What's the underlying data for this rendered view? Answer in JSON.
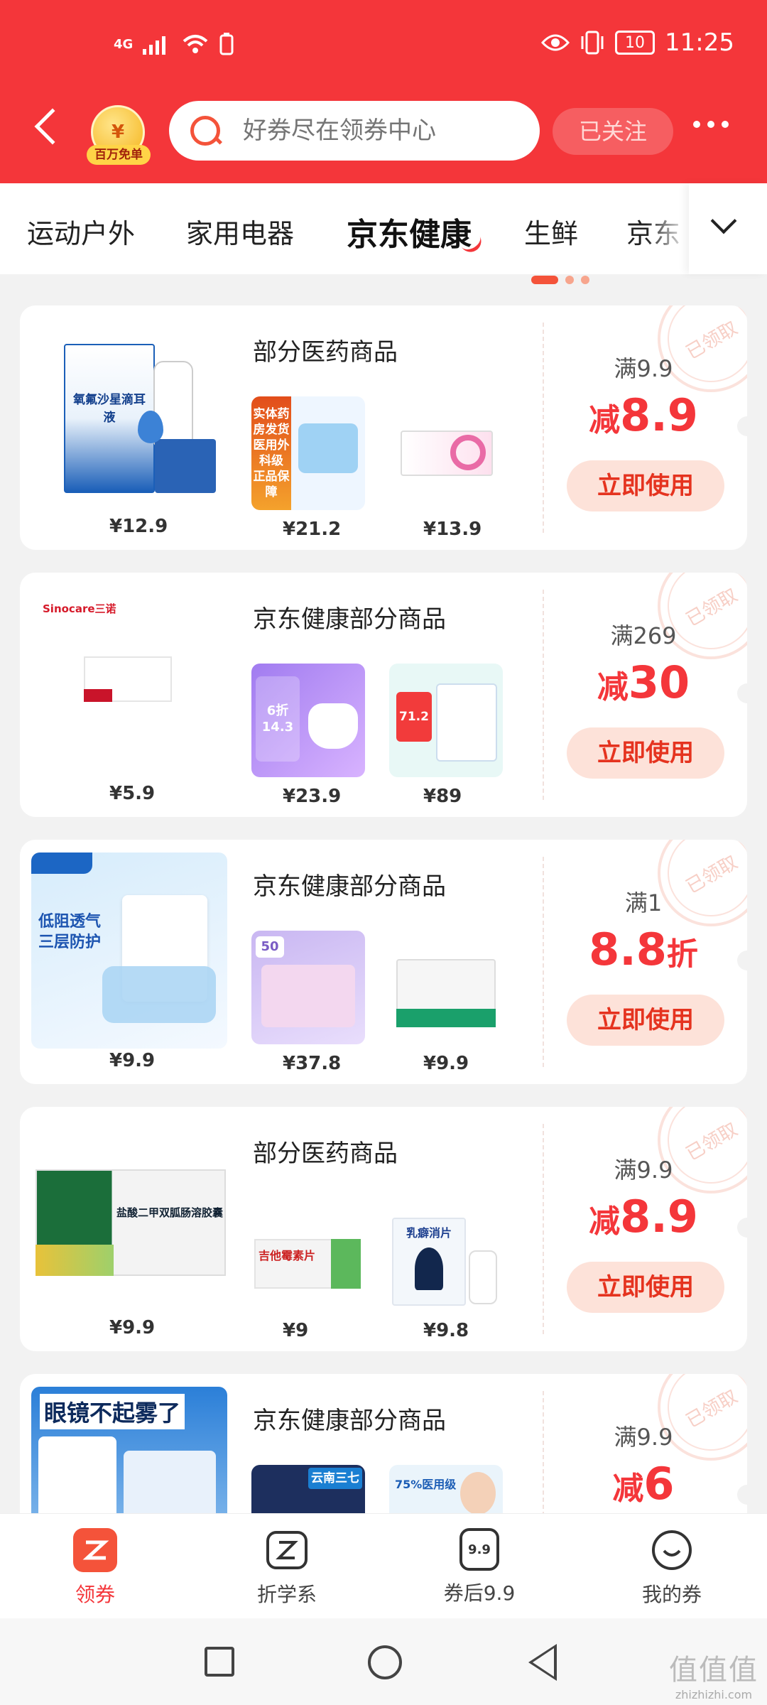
{
  "status_bar": {
    "network": "4G",
    "battery": "10",
    "time": "11:25"
  },
  "header": {
    "badge_label": "百万免单",
    "coin_symbol": "¥",
    "search_placeholder": "好券尽在领券中心",
    "follow_label": "已关注"
  },
  "tabs": [
    "运动户外",
    "家用电器",
    "京东健康",
    "生鲜",
    "京东"
  ],
  "active_tab": "京东健康",
  "coupons": [
    {
      "scope": "部分医药商品",
      "main_price": "¥12.9",
      "thumb_prices": [
        "¥21.2",
        "¥13.9"
      ],
      "condition": "满9.9",
      "benefit_prefix": "减",
      "benefit_value": "8.9",
      "benefit_suffix": "",
      "button": "立即使用",
      "stamp": "已领取",
      "main_img_text": "氧氟沙星滴耳液",
      "thumb1_text": "实体药房发货 医用外科级 正品保障",
      "thumb2_text": ""
    },
    {
      "scope": "京东健康部分商品",
      "main_price": "¥5.9",
      "thumb_prices": [
        "¥23.9",
        "¥89"
      ],
      "condition": "满269",
      "benefit_prefix": "减",
      "benefit_value": "30",
      "benefit_suffix": "",
      "button": "立即使用",
      "stamp": "已领取",
      "main_img_text": "Sinocare三诺",
      "thumb1_text": "6折 14.3",
      "thumb2_text": "71.2"
    },
    {
      "scope": "京东健康部分商品",
      "main_price": "¥9.9",
      "thumb_prices": [
        "¥37.8",
        "¥9.9"
      ],
      "condition": "满1",
      "benefit_prefix": "",
      "benefit_value": "8.8",
      "benefit_suffix": "折",
      "button": "立即使用",
      "stamp": "已领取",
      "main_img_text": "低阻透气 三层防护",
      "thumb1_text": "50",
      "thumb2_text": ""
    },
    {
      "scope": "部分医药商品",
      "main_price": "¥9.9",
      "thumb_prices": [
        "¥9",
        "¥9.8"
      ],
      "condition": "满9.9",
      "benefit_prefix": "减",
      "benefit_value": "8.9",
      "benefit_suffix": "",
      "button": "立即使用",
      "stamp": "已领取",
      "main_img_text": "盐酸二甲双胍肠溶胶囊",
      "thumb1_text": "吉他霉素片",
      "thumb2_text": "乳癖消片"
    },
    {
      "scope": "京东健康部分商品",
      "main_price": "",
      "thumb_prices": [
        "",
        ""
      ],
      "condition": "满9.9",
      "benefit_prefix": "减",
      "benefit_value": "6",
      "benefit_suffix": "",
      "button": "立即使用",
      "stamp": "已领取",
      "main_img_text": "眼镜不起雾了",
      "thumb1_text": "云南三七",
      "thumb2_text": "75%医用级"
    }
  ],
  "bottom_nav": [
    {
      "label": "领券",
      "icon": "coupon-icon",
      "active": true
    },
    {
      "label": "折学系",
      "icon": "z-icon",
      "active": false
    },
    {
      "label": "券后9.9",
      "icon": "price-tag-icon",
      "active": false,
      "icon_text": "9.9"
    },
    {
      "label": "我的券",
      "icon": "smile-icon",
      "active": false
    }
  ],
  "watermark": {
    "big": "值值值",
    "small": "zhizhizhi.com"
  },
  "colors": {
    "brand": "#f4363a",
    "accent": "#f4533a",
    "button_bg": "#fde2d9"
  }
}
